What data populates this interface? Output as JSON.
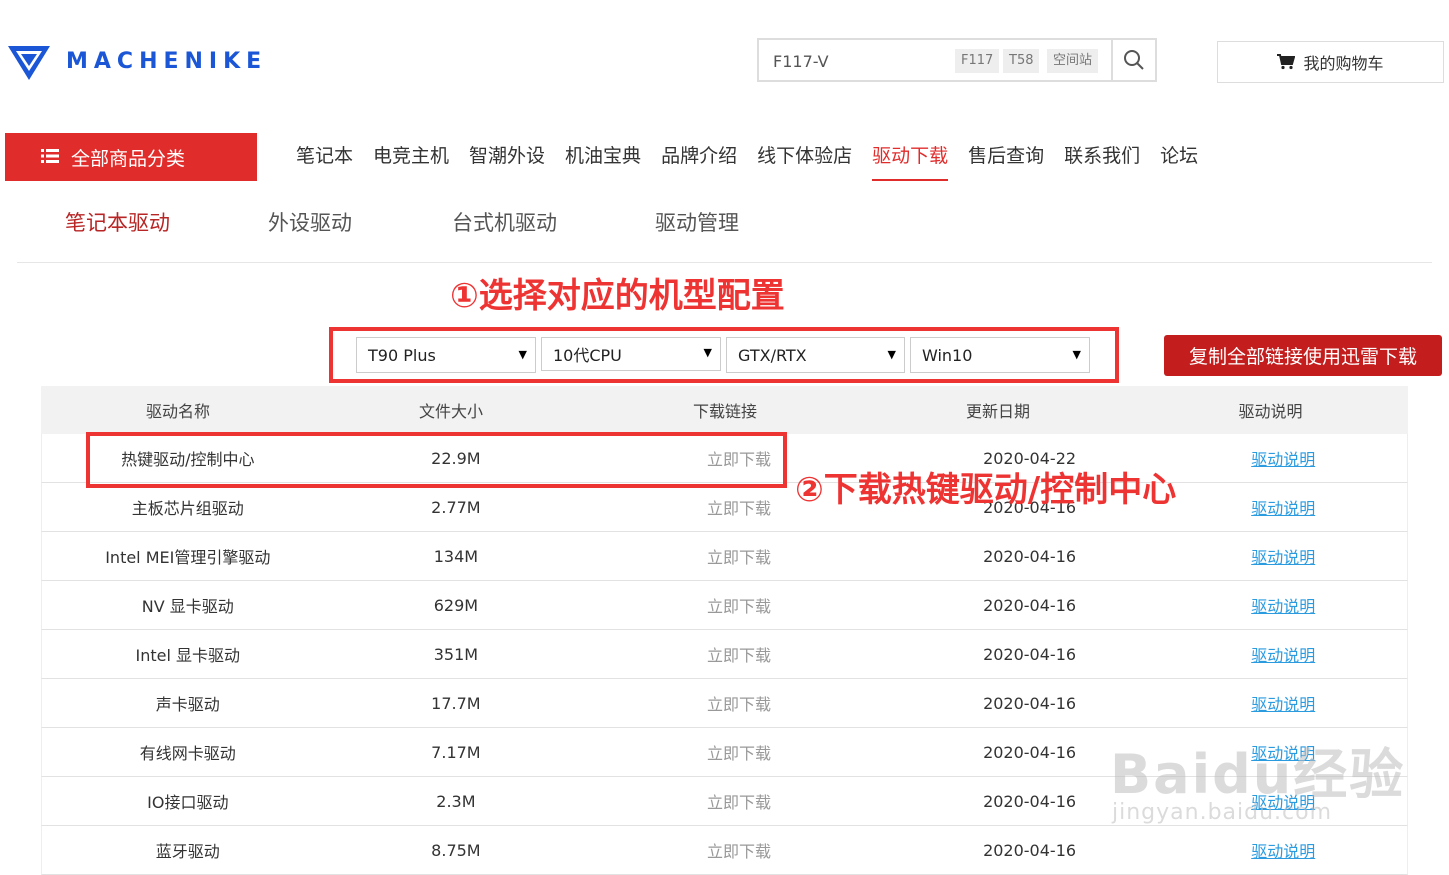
{
  "brand": {
    "name": "MACHENIKE",
    "color": "#1a56d6"
  },
  "search": {
    "value": "F117-V",
    "chips": [
      "F117",
      "T58",
      "空间站"
    ],
    "icon": "search-icon"
  },
  "cart": {
    "label": "我的购物车",
    "icon": "cart-icon"
  },
  "category_button": {
    "label": "全部商品分类",
    "icon": "menu-icon"
  },
  "nav": {
    "items": [
      "笔记本",
      "电竞主机",
      "智潮外设",
      "机油宝典",
      "品牌介绍",
      "线下体验店",
      "驱动下载",
      "售后查询",
      "联系我们",
      "论坛"
    ],
    "active": "驱动下载"
  },
  "subtabs": {
    "items": [
      "笔记本驱动",
      "外设驱动",
      "台式机驱动",
      "驱动管理"
    ],
    "active": "笔记本驱动"
  },
  "annotations": {
    "step1": "①选择对应的机型配置",
    "step2": "②下载热键驱动/控制中心"
  },
  "selects": {
    "model": "T90 Plus",
    "cpu": "10代CPU",
    "gpu": "GTX/RTX",
    "os": "Win10"
  },
  "copy_button": {
    "label": "复制全部链接使用迅雷下载"
  },
  "table": {
    "headers": [
      "驱动名称",
      "文件大小",
      "下载链接",
      "更新日期",
      "驱动说明"
    ],
    "rows": [
      {
        "name": "热键驱动/控制中心",
        "size": "22.9M",
        "link": "立即下载",
        "date": "2020-04-22",
        "desc": "驱动说明"
      },
      {
        "name": "主板芯片组驱动",
        "size": "2.77M",
        "link": "立即下载",
        "date": "2020-04-16",
        "desc": "驱动说明"
      },
      {
        "name": "Intel MEI管理引擎驱动",
        "size": "134M",
        "link": "立即下载",
        "date": "2020-04-16",
        "desc": "驱动说明"
      },
      {
        "name": "NV 显卡驱动",
        "size": "629M",
        "link": "立即下载",
        "date": "2020-04-16",
        "desc": "驱动说明"
      },
      {
        "name": "Intel 显卡驱动",
        "size": "351M",
        "link": "立即下载",
        "date": "2020-04-16",
        "desc": "驱动说明"
      },
      {
        "name": "声卡驱动",
        "size": "17.7M",
        "link": "立即下载",
        "date": "2020-04-16",
        "desc": "驱动说明"
      },
      {
        "name": "有线网卡驱动",
        "size": "7.17M",
        "link": "立即下载",
        "date": "2020-04-16",
        "desc": "驱动说明"
      },
      {
        "name": "IO接口驱动",
        "size": "2.3M",
        "link": "立即下载",
        "date": "2020-04-16",
        "desc": "驱动说明"
      },
      {
        "name": "蓝牙驱动",
        "size": "8.75M",
        "link": "立即下载",
        "date": "2020-04-16",
        "desc": "驱动说明"
      }
    ]
  },
  "watermark": {
    "line1": "Baidu经验",
    "line2": "jingyan.baidu.com"
  },
  "colors": {
    "accent": "#e12c2c",
    "copy_button": "#c41d1d",
    "annotation": "#ee3333",
    "link": "#2b9be0"
  }
}
